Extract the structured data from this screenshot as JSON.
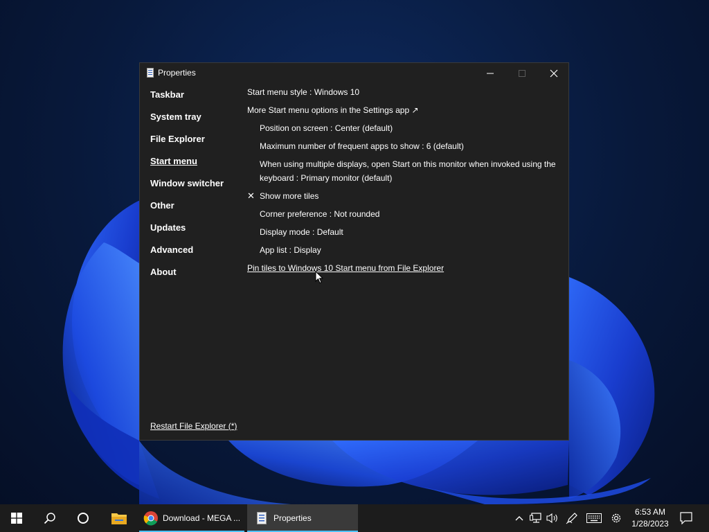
{
  "window": {
    "title": "Properties",
    "nav": [
      {
        "label": "Taskbar"
      },
      {
        "label": "System tray"
      },
      {
        "label": "File Explorer"
      },
      {
        "label": "Start menu"
      },
      {
        "label": "Window switcher"
      },
      {
        "label": "Other"
      },
      {
        "label": "Updates"
      },
      {
        "label": "Advanced"
      },
      {
        "label": "About"
      }
    ],
    "active_nav": "Start menu",
    "restart_link": "Restart File Explorer (*)",
    "options": {
      "start_menu_style": "Start menu style : Windows 10",
      "more_options": "More Start menu options in the Settings app ↗",
      "position": "Position on screen : Center (default)",
      "max_frequent": "Maximum number of frequent apps to show : 6 (default)",
      "multiple_displays": "When using multiple displays, open Start on this monitor when invoked using the keyboard : Primary monitor (default)",
      "show_more_tiles_mark": "✕",
      "show_more_tiles": "Show more tiles",
      "corner_preference": "Corner preference : Not rounded",
      "display_mode": "Display mode : Default",
      "app_list": "App list : Display",
      "pin_tiles": "Pin tiles to Windows 10 Start menu from File Explorer"
    }
  },
  "taskbar": {
    "apps": [
      {
        "label": "Download - MEGA ...",
        "icon": "chrome-icon"
      },
      {
        "label": "Properties",
        "icon": "properties-icon"
      }
    ],
    "clock": {
      "time": "6:53 AM",
      "date": "1/28/2023"
    }
  },
  "colors": {
    "window_bg": "#202020",
    "taskbar_bg": "#1c1c1c",
    "accent": "#4cc2ff"
  }
}
